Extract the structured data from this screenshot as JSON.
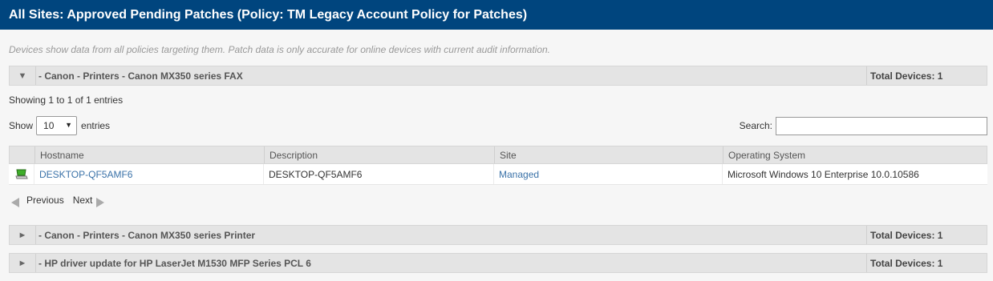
{
  "header": {
    "title": "All Sites: Approved Pending Patches (Policy: TM Legacy Account Policy for Patches)"
  },
  "note": "Devices show data from all policies targeting them. Patch data is only accurate for online devices with current audit information.",
  "groups": [
    {
      "toggle": "▼",
      "name": "- Canon - Printers - Canon MX350 series FAX",
      "total": "Total Devices: 1"
    },
    {
      "toggle": "►",
      "name": "- Canon - Printers - Canon MX350 series Printer",
      "total": "Total Devices: 1"
    },
    {
      "toggle": "►",
      "name": "- HP driver update for HP LaserJet M1530 MFP Series PCL 6",
      "total": "Total Devices: 1"
    }
  ],
  "table": {
    "info": "Showing 1 to 1 of 1 entries",
    "length": {
      "show_label": "Show",
      "value": "10",
      "entries_label": "entries"
    },
    "search_label": "Search:",
    "columns": [
      "Hostname",
      "Description",
      "Site",
      "Operating System"
    ],
    "rows": [
      {
        "icon": "computer-icon",
        "hostname": "DESKTOP-QF5AMF6",
        "description": "DESKTOP-QF5AMF6",
        "site": "Managed",
        "os": "Microsoft Windows 10 Enterprise 10.0.10586"
      }
    ],
    "pager": {
      "previous": "Previous",
      "next": "Next"
    }
  },
  "colors": {
    "header_bg": "#00457e",
    "link": "#3a72a8",
    "row_header_bg": "#e4e4e4"
  }
}
